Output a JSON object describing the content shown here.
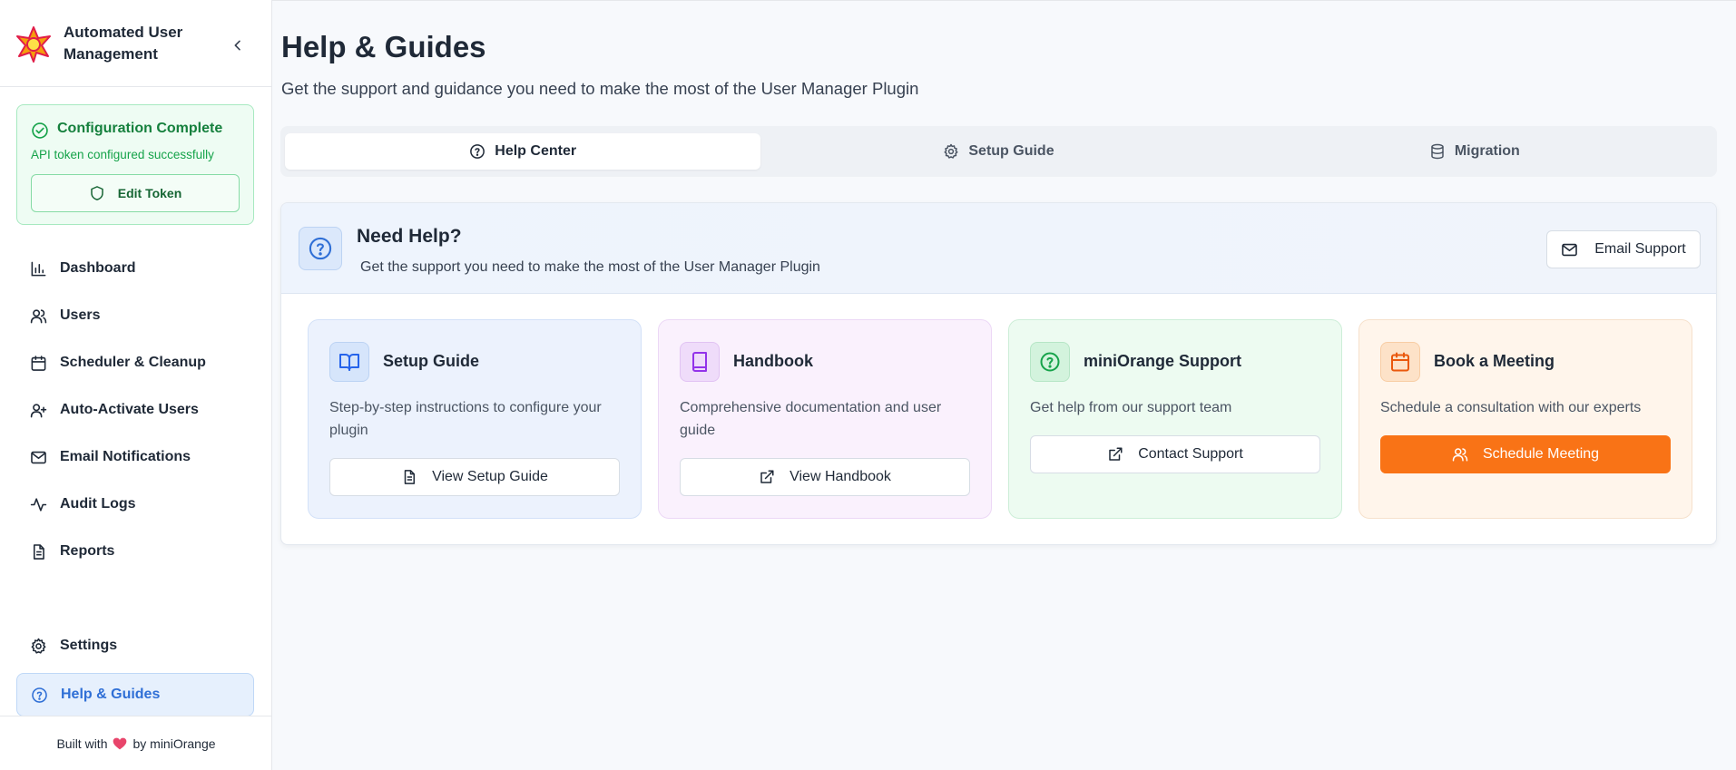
{
  "sidebar": {
    "app_title": "Automated User Management",
    "config": {
      "title": "Configuration Complete",
      "subtitle": "API token configured successfully",
      "edit_label": "Edit Token"
    },
    "nav": [
      {
        "label": "Dashboard",
        "icon": "bar-chart-icon"
      },
      {
        "label": "Users",
        "icon": "users-icon"
      },
      {
        "label": "Scheduler & Cleanup",
        "icon": "calendar-icon"
      },
      {
        "label": "Auto-Activate Users",
        "icon": "user-plus-icon"
      },
      {
        "label": "Email Notifications",
        "icon": "mail-icon"
      },
      {
        "label": "Audit Logs",
        "icon": "activity-icon"
      },
      {
        "label": "Reports",
        "icon": "file-icon"
      }
    ],
    "bottom_nav": [
      {
        "label": "Settings",
        "icon": "gear-icon"
      },
      {
        "label": "Help & Guides",
        "icon": "help-circle-icon",
        "active": true
      }
    ],
    "footer": {
      "prefix": "Built with",
      "suffix": "by miniOrange"
    }
  },
  "page": {
    "title": "Help & Guides",
    "subtitle": "Get the support and guidance you need to make the most of the User Manager Plugin"
  },
  "tabs": [
    {
      "label": "Help Center",
      "icon": "help-circle-icon",
      "active": true
    },
    {
      "label": "Setup Guide",
      "icon": "gear-icon"
    },
    {
      "label": "Migration",
      "icon": "database-icon"
    }
  ],
  "help": {
    "title": "Need Help?",
    "subtitle": "Get the support you need to make the most of the User Manager Plugin",
    "email_label": "Email Support"
  },
  "cards": [
    {
      "title": "Setup Guide",
      "desc": "Step-by-step instructions to configure your plugin",
      "button": "View Setup Guide",
      "icon": "book-open-icon",
      "button_icon": "document-icon",
      "bg": "#ecf2fd",
      "border": "#d3e1f8",
      "icon_bg": "#d6e5fb",
      "icon_color": "#2563eb"
    },
    {
      "title": "Handbook",
      "desc": "Comprehensive documentation and user guide",
      "button": "View Handbook",
      "icon": "book-icon",
      "button_icon": "external-link-icon",
      "bg": "#faf1fd",
      "border": "#ecd8f6",
      "icon_bg": "#efdcfa",
      "icon_color": "#9333ea"
    },
    {
      "title": "miniOrange Support",
      "desc": "Get help from our support team",
      "button": "Contact Support",
      "icon": "help-circle-icon",
      "button_icon": "external-link-icon",
      "bg": "#edfbf1",
      "border": "#cdeed8",
      "icon_bg": "#d3f3dd",
      "icon_color": "#16a34a"
    },
    {
      "title": "Book a Meeting",
      "desc": "Schedule a consultation with our experts",
      "button": "Schedule Meeting",
      "icon": "calendar-icon",
      "button_icon": "users-icon",
      "bg": "#fff5eb",
      "border": "#f6e1cc",
      "icon_bg": "#fde2c8",
      "icon_color": "#ea580c",
      "primary": true
    }
  ]
}
